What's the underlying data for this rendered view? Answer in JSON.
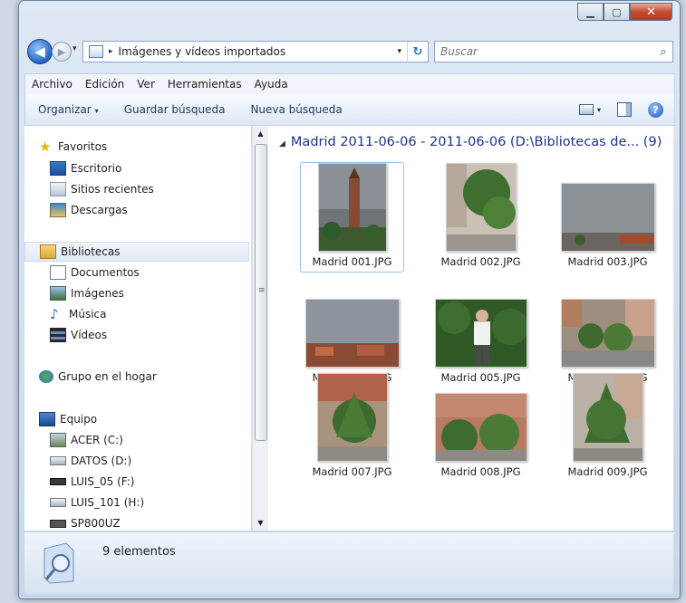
{
  "window": {
    "caption_min": "▁",
    "caption_max": "▢",
    "caption_close": "✕"
  },
  "nav": {
    "back_icon": "◀",
    "forward_icon": "▶",
    "history_icon": "▾",
    "address_chevron": "▸",
    "address": "Imágenes y vídeos importados",
    "address_drop": "▾",
    "refresh_icon": "↻",
    "search_placeholder": "Buscar",
    "search_icon": "⌕"
  },
  "menu": [
    "Archivo",
    "Edición",
    "Ver",
    "Herramientas",
    "Ayuda"
  ],
  "commands": {
    "organize": "Organizar",
    "organize_arrow": "▾",
    "save_search": "Guardar búsqueda",
    "new_search": "Nueva búsqueda",
    "view_arrow": "▾",
    "help": "?"
  },
  "sidebar": {
    "favorites": "Favoritos",
    "desktop": "Escritorio",
    "recent": "Sitios recientes",
    "downloads": "Descargas",
    "libraries": "Bibliotecas",
    "documents": "Documentos",
    "pictures": "Imágenes",
    "music": "Música",
    "videos": "Vídeos",
    "homegroup": "Grupo en el hogar",
    "computer": "Equipo",
    "drive_c": "ACER (C:)",
    "drive_d": "DATOS (D:)",
    "drive_f": "LUIS_05 (F:)",
    "drive_h": "LUIS_101 (H:)",
    "device": "SP800UZ"
  },
  "scrollbar": {
    "up": "▲",
    "down": "▼",
    "grip": "≡"
  },
  "group_header": "Madrid 2011-06-06 - 2011-06-06 (D:\\Bibliotecas de... (9)",
  "group_triangle": "◢",
  "files": [
    {
      "name": "Madrid 001.JPG"
    },
    {
      "name": "Madrid 002.JPG"
    },
    {
      "name": "Madrid 003.JPG"
    },
    {
      "name": "Madrid 004.JPG"
    },
    {
      "name": "Madrid 005.JPG"
    },
    {
      "name": "Madrid 006.JPG"
    },
    {
      "name": "Madrid 007.JPG"
    },
    {
      "name": "Madrid 008.JPG"
    },
    {
      "name": "Madrid 009.JPG"
    }
  ],
  "status": {
    "count": "9 elementos"
  },
  "colors": {
    "accent": "#1e3287",
    "selection": "#9fc0e6",
    "frame": "#c7d6ea"
  }
}
